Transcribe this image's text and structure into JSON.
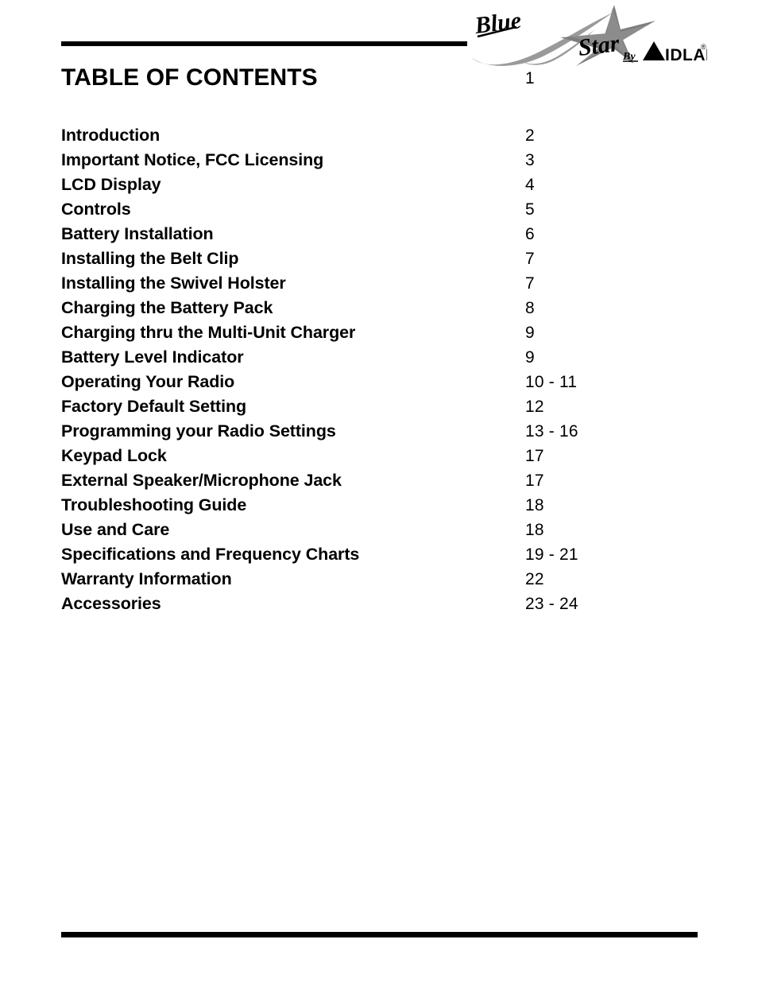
{
  "document": {
    "page_title": "TABLE OF CONTENTS",
    "page_number": "1"
  },
  "logo": {
    "brand_line1": "Blue",
    "brand_line2": "Star",
    "by_label": "By",
    "manufacturer": "MIDLAND",
    "trademark": "®",
    "star_color": "#808080",
    "text_color": "#000000"
  },
  "toc": {
    "entries": [
      {
        "label": "Introduction",
        "pages": "2"
      },
      {
        "label": "Important Notice, FCC Licensing",
        "pages": "3"
      },
      {
        "label": "LCD Display",
        "pages": "4"
      },
      {
        "label": "Controls",
        "pages": "5"
      },
      {
        "label": "Battery Installation",
        "pages": "6"
      },
      {
        "label": "Installing the Belt Clip",
        "pages": "7"
      },
      {
        "label": "Installing the Swivel Holster",
        "pages": "7"
      },
      {
        "label": "Charging the Battery Pack",
        "pages": "8"
      },
      {
        "label": "Charging thru the Multi-Unit Charger",
        "pages": "9"
      },
      {
        "label": "Battery Level Indicator",
        "pages": "9"
      },
      {
        "label": "Operating Your Radio",
        "pages": "10 - 11"
      },
      {
        "label": "Factory Default Setting",
        "pages": "12"
      },
      {
        "label": "Programming your Radio Settings",
        "pages": "13 - 16"
      },
      {
        "label": "Keypad Lock",
        "pages": "17"
      },
      {
        "label": "External Speaker/Microphone Jack",
        "pages": "17"
      },
      {
        "label": "Troubleshooting Guide",
        "pages": "18"
      },
      {
        "label": "Use and Care",
        "pages": "18"
      },
      {
        "label": "Specifications and Frequency Charts",
        "pages": "19 - 21"
      },
      {
        "label": "Warranty Information",
        "pages": "22"
      },
      {
        "label": "Accessories",
        "pages": "23 - 24"
      }
    ]
  }
}
